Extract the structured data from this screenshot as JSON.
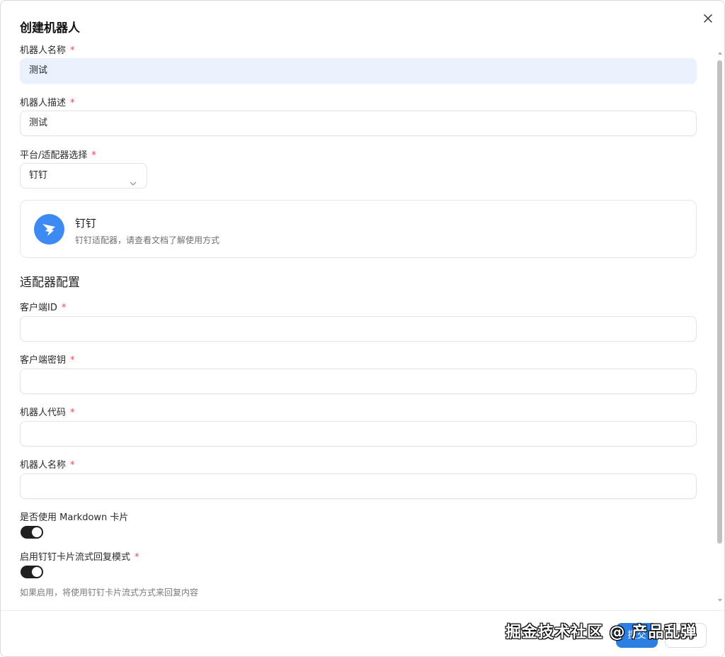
{
  "dialog": {
    "title": "创建机器人"
  },
  "fields": {
    "bot_name": {
      "label": "机器人名称",
      "required_mark": "*",
      "value": "测试"
    },
    "bot_desc": {
      "label": "机器人描述",
      "required_mark": "*",
      "value": "测试"
    },
    "platform": {
      "label": "平台/适配器选择",
      "required_mark": "*",
      "selected": "钉钉"
    }
  },
  "adapter_card": {
    "title": "钉钉",
    "description": "钉钉适配器，请查看文档了解使用方式",
    "icon": "dingtalk-logo-icon",
    "color": "#3d8bf2"
  },
  "config": {
    "section_title": "适配器配置",
    "client_id": {
      "label": "客户端ID",
      "required_mark": "*",
      "value": ""
    },
    "client_secret": {
      "label": "客户端密钥",
      "required_mark": "*",
      "value": ""
    },
    "robot_code": {
      "label": "机器人代码",
      "required_mark": "*",
      "value": ""
    },
    "robot_name": {
      "label": "机器人名称",
      "required_mark": "*",
      "value": ""
    },
    "markdown_card": {
      "label": "是否使用 Markdown 卡片",
      "enabled": true
    },
    "stream_mode": {
      "label": "启用钉钉卡片流式回复模式",
      "required_mark": "*",
      "enabled": true,
      "hint": "如果启用，将使用钉钉卡片流式方式来回复内容"
    }
  },
  "footer": {
    "submit_label": "提交",
    "cancel_label": "取消",
    "watermark": "掘金技术社区 @ 产品乱弹"
  },
  "colors": {
    "primary": "#2b7fe3",
    "required": "#e5484d",
    "toggle_on": "#1f1f1f",
    "selected_input_bg": "#e9f1fd"
  }
}
